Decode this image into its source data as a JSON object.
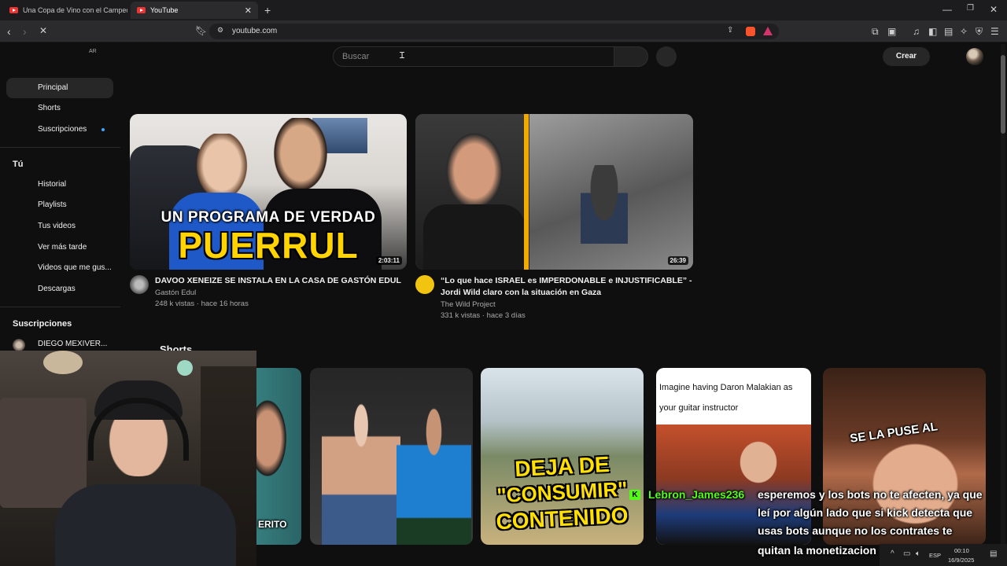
{
  "browser": {
    "tabs": [
      {
        "title": "Una Copa de Vino con el Campeón d"
      },
      {
        "title": "YouTube"
      }
    ],
    "url": "youtube.com"
  },
  "youtube": {
    "region": "AR",
    "search_placeholder": "Buscar",
    "create_label": "Crear",
    "sidebar": {
      "main": [
        "Principal",
        "Shorts",
        "Suscripciones"
      ],
      "you_heading": "Tú",
      "you_items": [
        "Historial",
        "Playlists",
        "Tus videos",
        "Ver más tarde",
        "Videos que me gus...",
        "Descargas"
      ],
      "subs_heading": "Suscripciones",
      "subs": [
        "DIEGO MEXIVER..."
      ]
    },
    "videos": [
      {
        "thumb_top": "UN PROGRAMA DE VERDAD",
        "thumb_big": "PUERRUL",
        "duration": "2:03:11",
        "title": "DAVOO XENEIZE SE INSTALA EN LA CASA DE GASTÓN EDUL",
        "channel": "Gastón Edul",
        "meta": "248 k vistas · hace 16 horas"
      },
      {
        "duration": "26:39",
        "title_1": "“Lo que hace ISRAEL es IMPERDONABLE e INJUSTIFICABLE” -",
        "title_2": "Jordi Wild claro con la situación en Gaza",
        "channel": "The Wild Project",
        "meta": "331 k vistas · hace 3 días"
      }
    ],
    "shorts_heading": "Shorts",
    "shorts": [
      {
        "overlay": "ERITO"
      },
      {
        "overlay": ""
      },
      {
        "overlay_1": "DEJA DE",
        "overlay_2": "\"CONSUMIR\"",
        "overlay_3": "CONTENIDO"
      },
      {
        "overlay_1": "Imagine having Daron Malakian as",
        "overlay_2": "your guitar instructor"
      },
      {
        "overlay": "SE LA PUSE AL"
      }
    ]
  },
  "chat": {
    "username": "Lebron_James236",
    "message_lines": [
      "esperemos y los bots no te afecten, ya que",
      "leí por algún lado que si kick detecta que",
      "usas bots aunque no los contrates te",
      "quitan la monetizacion"
    ]
  },
  "taskbar": {
    "lang": "ESP",
    "time": "00:10",
    "date": "16/9/2025"
  },
  "colors": {
    "yt_bg": "#0f0f0f",
    "chat_user": "#53fc18",
    "notification_dot": "#3ea6ff"
  }
}
